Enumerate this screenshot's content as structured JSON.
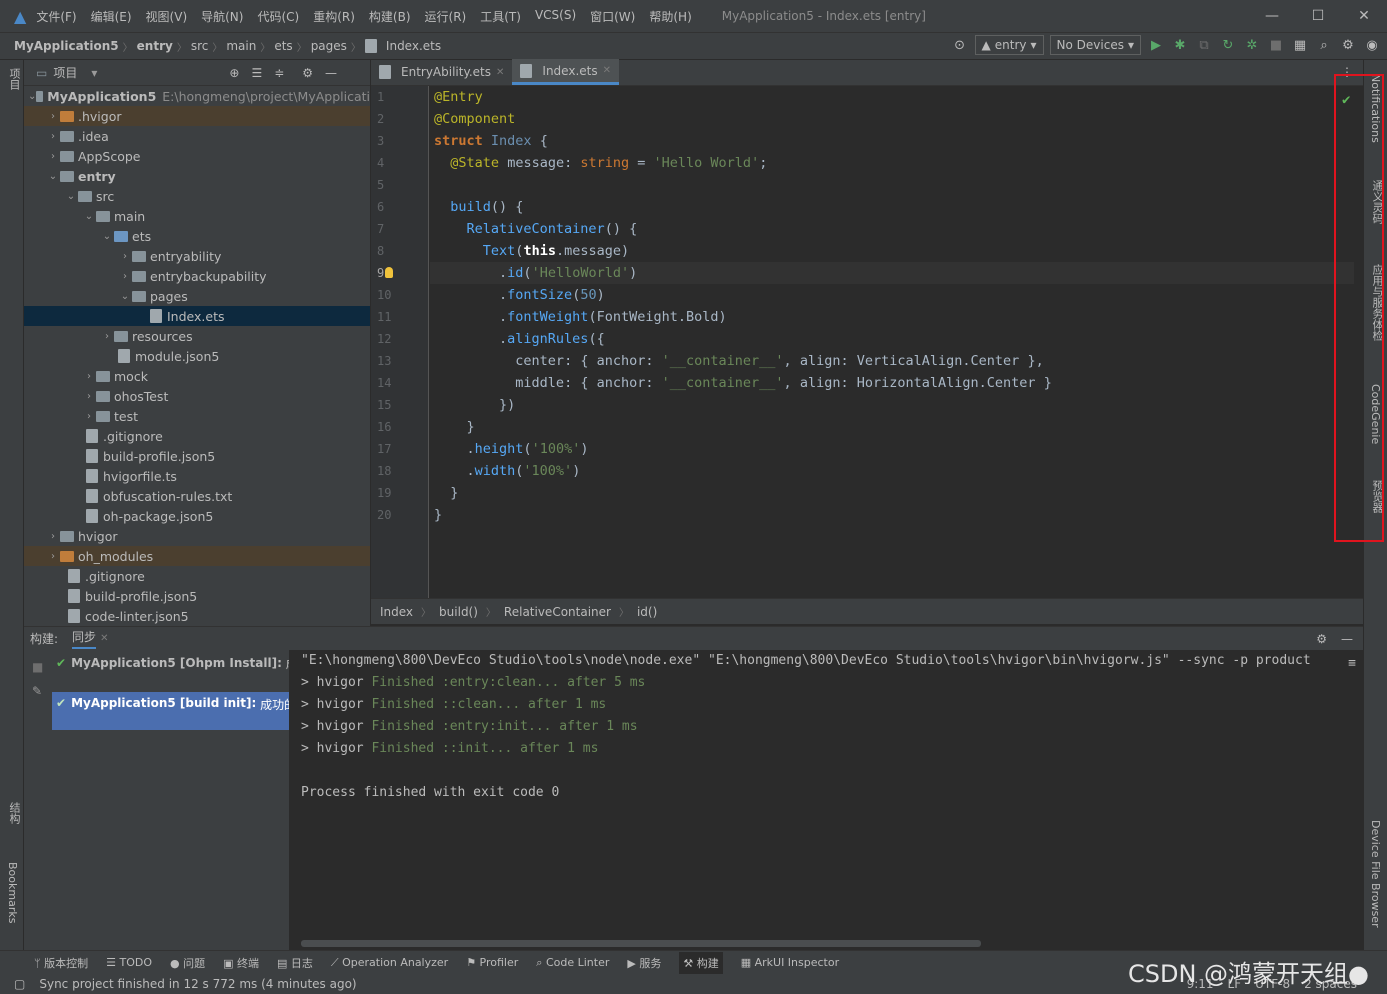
{
  "titlebar": {
    "menus": [
      "文件(F)",
      "编辑(E)",
      "视图(V)",
      "导航(N)",
      "代码(C)",
      "重构(R)",
      "构建(B)",
      "运行(R)",
      "工具(T)",
      "VCS(S)",
      "窗口(W)",
      "帮助(H)"
    ],
    "title": "MyApplication5 - Index.ets [entry]"
  },
  "navbar": {
    "crumbs": [
      "MyApplication5",
      "entry",
      "src",
      "main",
      "ets",
      "pages",
      "Index.ets"
    ],
    "module": "entry",
    "device": "No Devices"
  },
  "leftstrip": {
    "project": "项目",
    "structure": "结构",
    "bookmarks": "Bookmarks"
  },
  "project": {
    "header": "项目",
    "rows": [
      {
        "label": "MyApplication5",
        "path": "E:\\hongmeng\\project\\MyApplicati"
      },
      {
        "label": ".hvigor"
      },
      {
        "label": ".idea"
      },
      {
        "label": "AppScope"
      },
      {
        "label": "entry"
      },
      {
        "label": "src"
      },
      {
        "label": "main"
      },
      {
        "label": "ets"
      },
      {
        "label": "entryability"
      },
      {
        "label": "entrybackupability"
      },
      {
        "label": "pages"
      },
      {
        "label": "Index.ets"
      },
      {
        "label": "resources"
      },
      {
        "label": "module.json5"
      },
      {
        "label": "mock"
      },
      {
        "label": "ohosTest"
      },
      {
        "label": "test"
      },
      {
        "label": ".gitignore"
      },
      {
        "label": "build-profile.json5"
      },
      {
        "label": "hvigorfile.ts"
      },
      {
        "label": "obfuscation-rules.txt"
      },
      {
        "label": "oh-package.json5"
      },
      {
        "label": "hvigor"
      },
      {
        "label": "oh_modules"
      },
      {
        "label": ".gitignore"
      },
      {
        "label": "build-profile.json5"
      },
      {
        "label": "code-linter.json5"
      }
    ]
  },
  "tabs": [
    {
      "label": "EntryAbility.ets"
    },
    {
      "label": "Index.ets"
    }
  ],
  "editor": {
    "line_numbers": [
      "1",
      "2",
      "3",
      "4",
      "5",
      "6",
      "7",
      "8",
      "9",
      "10",
      "11",
      "12",
      "13",
      "14",
      "15",
      "16",
      "17",
      "18",
      "19",
      "20"
    ],
    "l1": "@Entry",
    "l2": "@Component",
    "l3a": "struct",
    "l3b": "Index",
    "l4a": "@State",
    "l4b": "message",
    "l4c": "string",
    "l4d": "'Hello World'",
    "l6": "build",
    "l7": "RelativeContainer",
    "l8a": "Text",
    "l8b": "this",
    "l8c": "message",
    "l9a": "id",
    "l9b": "'HelloWorld'",
    "l10a": "fontSize",
    "l10b": "50",
    "l11a": "fontWeight",
    "l11b": "FontWeight",
    "l11c": "Bold",
    "l12": "alignRules",
    "l13a": "center",
    "l13b": "anchor",
    "l13c": "'__container__'",
    "l13d": "align",
    "l13e": "VerticalAlign",
    "l13f": "Center",
    "l14a": "middle",
    "l14b": "anchor",
    "l14c": "'__container__'",
    "l14d": "align",
    "l14e": "HorizontalAlign",
    "l14f": "Center",
    "l17a": "height",
    "l17b": "'100%'",
    "l18a": "width",
    "l18b": "'100%'"
  },
  "codecrumb": [
    "Index",
    "build()",
    "RelativeContainer",
    "id()"
  ],
  "rightstrip": {
    "notifications": "Notifications",
    "t2": "通义灵码",
    "t3": "应用与服务体检",
    "codegenie": "CodeGenie",
    "preview": "预览器",
    "device": "Device File Browser"
  },
  "bottom": {
    "build": "构建:",
    "sync": "同步",
    "items": [
      {
        "label": "MyApplication5 [Ohpm Install]:",
        "status": "成功"
      },
      {
        "label": "MyApplication5 [build init]:",
        "status": "成功的"
      }
    ],
    "console": {
      "cmd": "\"E:\\hongmeng\\800\\DevEco Studio\\tools\\node\\node.exe\" \"E:\\hongmeng\\800\\DevEco Studio\\tools\\hvigor\\bin\\hvigorw.js\" --sync -p product",
      "lines": [
        {
          "pre": "> hvigor ",
          "fin": "Finished :entry:clean... after 5 ms"
        },
        {
          "pre": "> hvigor ",
          "fin": "Finished ::clean... after 1 ms"
        },
        {
          "pre": "> hvigor ",
          "fin": "Finished :entry:init... after 1 ms"
        },
        {
          "pre": "> hvigor ",
          "fin": "Finished ::init... after 1 ms"
        }
      ],
      "exit": "Process finished with exit code 0"
    }
  },
  "statusbar": [
    "版本控制",
    "TODO",
    "问题",
    "终端",
    "日志",
    "Operation Analyzer",
    "Profiler",
    "Code Linter",
    "服务",
    "构建",
    "ArkUI Inspector"
  ],
  "message": "Sync project finished in 12 s 772 ms (4 minutes ago)",
  "status_right": [
    "9:11",
    "LF",
    "UTF-8",
    "2 spaces"
  ],
  "watermark": "CSDN @鸿蒙开天组●"
}
